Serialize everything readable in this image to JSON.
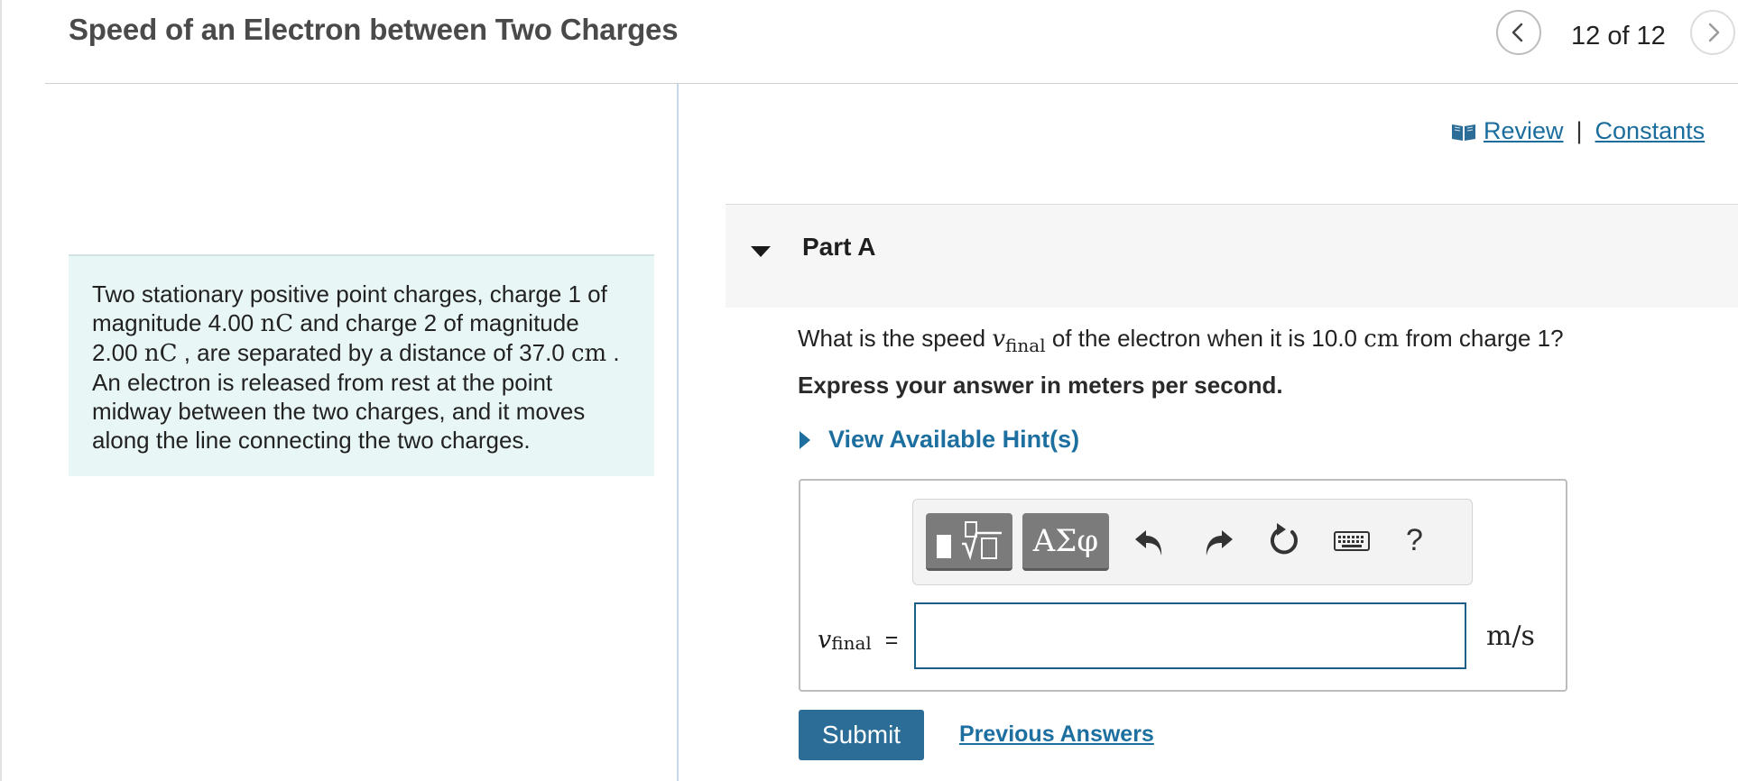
{
  "header": {
    "title": "Speed of an Electron between Two Charges",
    "counter": "12 of 12",
    "prev_icon": "chevron-left-icon",
    "next_icon": "chevron-right-icon"
  },
  "intro": {
    "seg1": "Two stationary positive point charges, charge 1 of magnitude 4.00 ",
    "unit_nC_1": "nC",
    "seg2": " and charge 2 of magnitude 2.00 ",
    "unit_nC_2": "nC",
    "seg3": " , are separated by a distance of 37.0 ",
    "unit_cm": "cm",
    "seg4": " . An electron is released from rest at the point midway between the two charges, and it moves along the line connecting the two charges."
  },
  "links": {
    "review": "Review",
    "separator": "|",
    "constants": "Constants",
    "review_icon": "book-icon"
  },
  "part": {
    "label": "Part A",
    "toggle_icon": "triangle-down-icon"
  },
  "question": {
    "prefix": "What is the speed ",
    "var": "v",
    "sub": "final",
    "middle": " of the electron when it is 10.0 ",
    "unit": "cm",
    "suffix": " from charge 1?",
    "instruction": "Express your answer in meters per second."
  },
  "hint": {
    "label": "View Available Hint(s)",
    "icon": "triangle-right-icon"
  },
  "toolbar": {
    "symbols_label": "ΑΣφ",
    "help_label": "?",
    "icons": [
      "templates-icon",
      "undo-icon",
      "redo-icon",
      "reset-icon",
      "keyboard-icon"
    ]
  },
  "answer": {
    "var": "v",
    "sub": "final",
    "equals": "=",
    "value": "",
    "unit": "m/s"
  },
  "actions": {
    "submit": "Submit",
    "previous_answers": "Previous Answers"
  },
  "colors": {
    "accent": "#2c6d97",
    "link": "#1d6fa0",
    "intro_bg": "#e8f6f5",
    "part_bg": "#f6f6f6"
  }
}
